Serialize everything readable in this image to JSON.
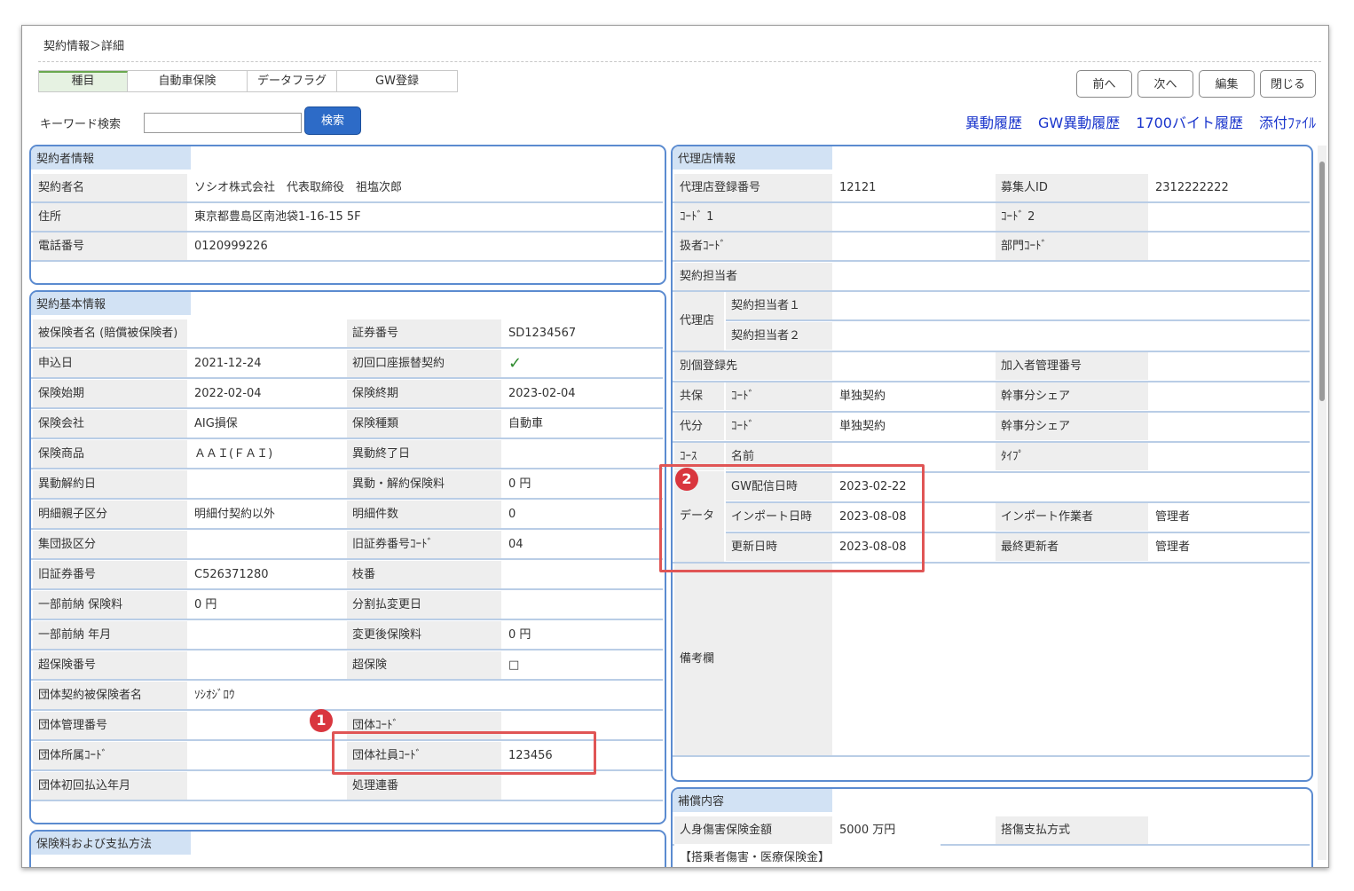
{
  "breadcrumb": "契約情報＞詳細",
  "tabs": [
    "種目",
    "自動車保険",
    "データフラグ",
    "GW登録"
  ],
  "nav_buttons": {
    "prev": "前へ",
    "next": "次へ",
    "edit": "編集",
    "close": "閉じる"
  },
  "search": {
    "label": "キーワード検索",
    "value": "",
    "button": "検索"
  },
  "links": [
    "異動履歴",
    "GW異動履歴",
    "1700バイト履歴",
    "添付ﾌｧｲﾙ"
  ],
  "contractor": {
    "title": "契約者情報",
    "name_label": "契約者名",
    "name": "ソシオ株式会社　代表取締役　祖塩次郎",
    "address_label": "住所",
    "address": "東京都豊島区南池袋1-16-15 5F",
    "phone_label": "電話番号",
    "phone": "0120999226"
  },
  "basic": {
    "title": "契約基本情報",
    "rows": [
      [
        "被保険者名 (賠償被保険者)",
        "",
        "証券番号",
        "SD1234567"
      ],
      [
        "申込日",
        "2021-12-24",
        "初回口座振替契約",
        "✓"
      ],
      [
        "保険始期",
        "2022-02-04",
        "保険終期",
        "2023-02-04"
      ],
      [
        "保険会社",
        "AIG損保",
        "保険種類",
        "自動車"
      ],
      [
        "保険商品",
        "ＡＡＩ(ＦＡＩ)",
        "異動終了日",
        ""
      ],
      [
        "異動解約日",
        "",
        "異動・解約保険料",
        "0 円"
      ],
      [
        "明細親子区分",
        "明細付契約以外",
        "明細件数",
        "0"
      ],
      [
        "集団扱区分",
        "",
        "旧証券番号ｺｰﾄﾞ",
        "04"
      ],
      [
        "旧証券番号",
        "C526371280",
        "枝番",
        ""
      ],
      [
        "一部前納 保険料",
        "0 円",
        "分割払変更日",
        ""
      ],
      [
        "一部前納 年月",
        "",
        "変更後保険料",
        "0 円"
      ],
      [
        "超保険番号",
        "",
        "超保険",
        "□"
      ],
      [
        "団体契約被保険者名",
        "ｿｼｵｼﾞﾛｳ",
        "",
        ""
      ],
      [
        "団体管理番号",
        "",
        "団体ｺｰﾄﾞ",
        ""
      ],
      [
        "団体所属ｺｰﾄﾞ",
        "",
        "団体社員ｺｰﾄﾞ",
        "123456"
      ],
      [
        "団体初回払込年月",
        "",
        "処理連番",
        ""
      ]
    ]
  },
  "payment": {
    "title": "保険料および支払方法"
  },
  "agency": {
    "title": "代理店情報",
    "reg_no_label": "代理店登録番号",
    "reg_no": "12121",
    "recruiter_label": "募集人ID",
    "recruiter": "2312222222",
    "code1_label": "ｺｰﾄﾞ 1",
    "code2_label": "ｺｰﾄﾞ 2",
    "handler_code_label": "扱者ｺｰﾄﾞ",
    "dept_code_label": "部門ｺｰﾄﾞ",
    "contract_person_label": "契約担当者",
    "agency_label": "代理店",
    "person1_label": "契約担当者１",
    "person2_label": "契約担当者２",
    "separate_label": "別個登録先",
    "member_no_label": "加入者管理番号",
    "coins_label": "共保",
    "code_label": "ｺｰﾄﾞ",
    "coins_value": "単独契約",
    "share_label": "幹事分シェア",
    "proxy_label": "代分",
    "proxy_value": "単独契約",
    "course_label": "ｺｰｽ",
    "name_label": "名前",
    "type_label": "ﾀｲﾌﾟ",
    "data_label": "データ",
    "gw_date_label": "GW配信日時",
    "gw_date": "2023-02-22",
    "import_date_label": "インポート日時",
    "import_date": "2023-08-08",
    "importer_label": "インポート作業者",
    "importer": "管理者",
    "updated_label": "更新日時",
    "updated": "2023-08-08",
    "updater_label": "最終更新者",
    "updater": "管理者",
    "remarks_label": "備考欄"
  },
  "compensation": {
    "title": "補償内容",
    "personal_label": "人身傷害保険金額",
    "personal_value": "5000 万円",
    "payment_label": "搭傷支払方式",
    "section_label": "【搭乗者傷害・医療保険金】"
  },
  "badges": [
    "1",
    "2"
  ],
  "colors": {
    "accent": "#2d6bc7",
    "panel_border": "#5b8bd0",
    "title_bg": "#d2e2f4",
    "highlight": "#e05555"
  }
}
